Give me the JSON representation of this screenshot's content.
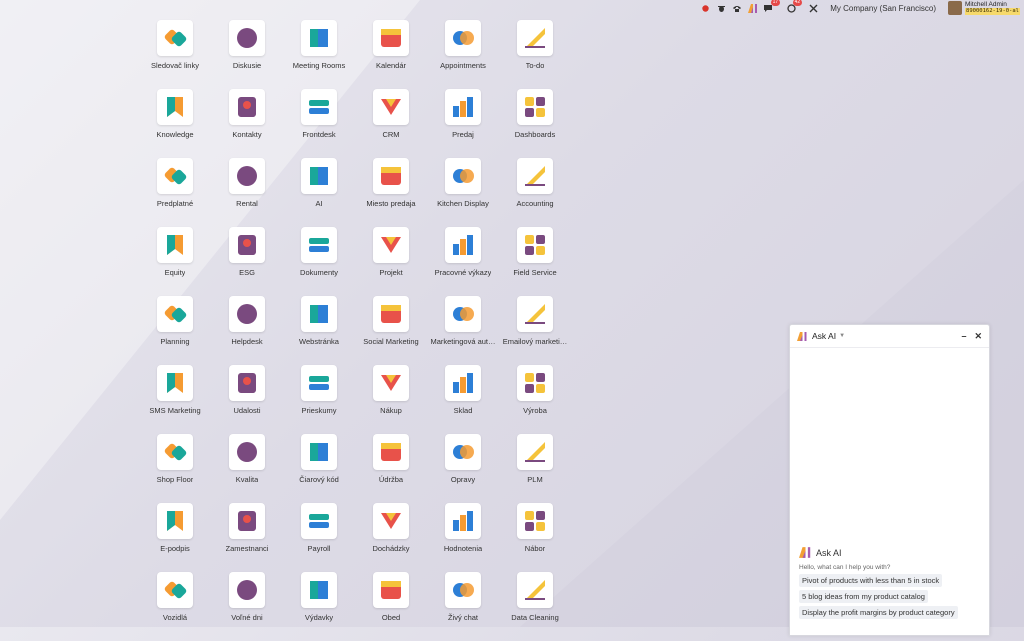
{
  "systray": {
    "discuss_badge": "17",
    "activity_badge": "42",
    "company": "My Company (San Francisco)",
    "user_name": "Mitchell Admin",
    "db_name": "89000162-19-0-al"
  },
  "apps": [
    {
      "label": "Sledovač linky",
      "icon": "link-tracker-icon"
    },
    {
      "label": "Diskusie",
      "icon": "discuss-icon"
    },
    {
      "label": "Meeting Rooms",
      "icon": "meeting-rooms-icon"
    },
    {
      "label": "Kalendár",
      "icon": "calendar-icon"
    },
    {
      "label": "Appointments",
      "icon": "appointments-icon"
    },
    {
      "label": "To-do",
      "icon": "todo-icon"
    },
    {
      "label": "Knowledge",
      "icon": "knowledge-icon"
    },
    {
      "label": "Kontakty",
      "icon": "contacts-icon"
    },
    {
      "label": "Frontdesk",
      "icon": "frontdesk-icon"
    },
    {
      "label": "CRM",
      "icon": "crm-icon"
    },
    {
      "label": "Predaj",
      "icon": "sales-icon"
    },
    {
      "label": "Dashboards",
      "icon": "dashboards-icon"
    },
    {
      "label": "Predplatné",
      "icon": "subscriptions-icon"
    },
    {
      "label": "Rental",
      "icon": "rental-icon"
    },
    {
      "label": "AI",
      "icon": "ai-icon"
    },
    {
      "label": "Miesto predaja",
      "icon": "point-of-sale-icon"
    },
    {
      "label": "Kitchen Display",
      "icon": "kitchen-display-icon"
    },
    {
      "label": "Accounting",
      "icon": "accounting-icon"
    },
    {
      "label": "Equity",
      "icon": "equity-icon"
    },
    {
      "label": "ESG",
      "icon": "esg-icon"
    },
    {
      "label": "Dokumenty",
      "icon": "documents-icon"
    },
    {
      "label": "Projekt",
      "icon": "project-icon"
    },
    {
      "label": "Pracovné výkazy",
      "icon": "timesheets-icon"
    },
    {
      "label": "Field Service",
      "icon": "field-service-icon"
    },
    {
      "label": "Planning",
      "icon": "planning-icon"
    },
    {
      "label": "Helpdesk",
      "icon": "helpdesk-icon"
    },
    {
      "label": "Webstránka",
      "icon": "website-icon"
    },
    {
      "label": "Social Marketing",
      "icon": "social-marketing-icon"
    },
    {
      "label": "Marketingová aut…",
      "icon": "marketing-automation-icon"
    },
    {
      "label": "Emailový marketi…",
      "icon": "email-marketing-icon"
    },
    {
      "label": "SMS Marketing",
      "icon": "sms-marketing-icon"
    },
    {
      "label": "Udalosti",
      "icon": "events-icon"
    },
    {
      "label": "Prieskumy",
      "icon": "surveys-icon"
    },
    {
      "label": "Nákup",
      "icon": "purchase-icon"
    },
    {
      "label": "Sklad",
      "icon": "inventory-icon"
    },
    {
      "label": "Výroba",
      "icon": "manufacturing-icon"
    },
    {
      "label": "Shop Floor",
      "icon": "shop-floor-icon"
    },
    {
      "label": "Kvalita",
      "icon": "quality-icon"
    },
    {
      "label": "Čiarový kód",
      "icon": "barcode-icon"
    },
    {
      "label": "Údržba",
      "icon": "maintenance-icon"
    },
    {
      "label": "Opravy",
      "icon": "repairs-icon"
    },
    {
      "label": "PLM",
      "icon": "plm-icon"
    },
    {
      "label": "E-podpis",
      "icon": "sign-icon"
    },
    {
      "label": "Zamestnanci",
      "icon": "employees-icon"
    },
    {
      "label": "Payroll",
      "icon": "payroll-icon"
    },
    {
      "label": "Dochádzky",
      "icon": "attendances-icon"
    },
    {
      "label": "Hodnotenia",
      "icon": "appraisals-icon"
    },
    {
      "label": "Nábor",
      "icon": "recruitment-icon"
    },
    {
      "label": "Vozidlá",
      "icon": "fleet-icon"
    },
    {
      "label": "Voľné dni",
      "icon": "time-off-icon"
    },
    {
      "label": "Výdavky",
      "icon": "expenses-icon"
    },
    {
      "label": "Obed",
      "icon": "lunch-icon"
    },
    {
      "label": "Živý chat",
      "icon": "live-chat-icon"
    },
    {
      "label": "Data Cleaning",
      "icon": "data-cleaning-icon"
    }
  ],
  "ask_ai": {
    "title": "Ask AI",
    "heading": "Ask AI",
    "greeting": "Hello, what can I help you with?",
    "suggestions": [
      "Pivot of products with less than 5 in stock",
      "5 blog ideas from my product catalog",
      "Display the profit margins by product category"
    ]
  },
  "colors": {
    "purple": "#7a4a7f",
    "orange": "#f59b32",
    "teal": "#1aa79a",
    "red": "#e8524a",
    "blue": "#2d7fd6",
    "yellow": "#f5c33b"
  }
}
